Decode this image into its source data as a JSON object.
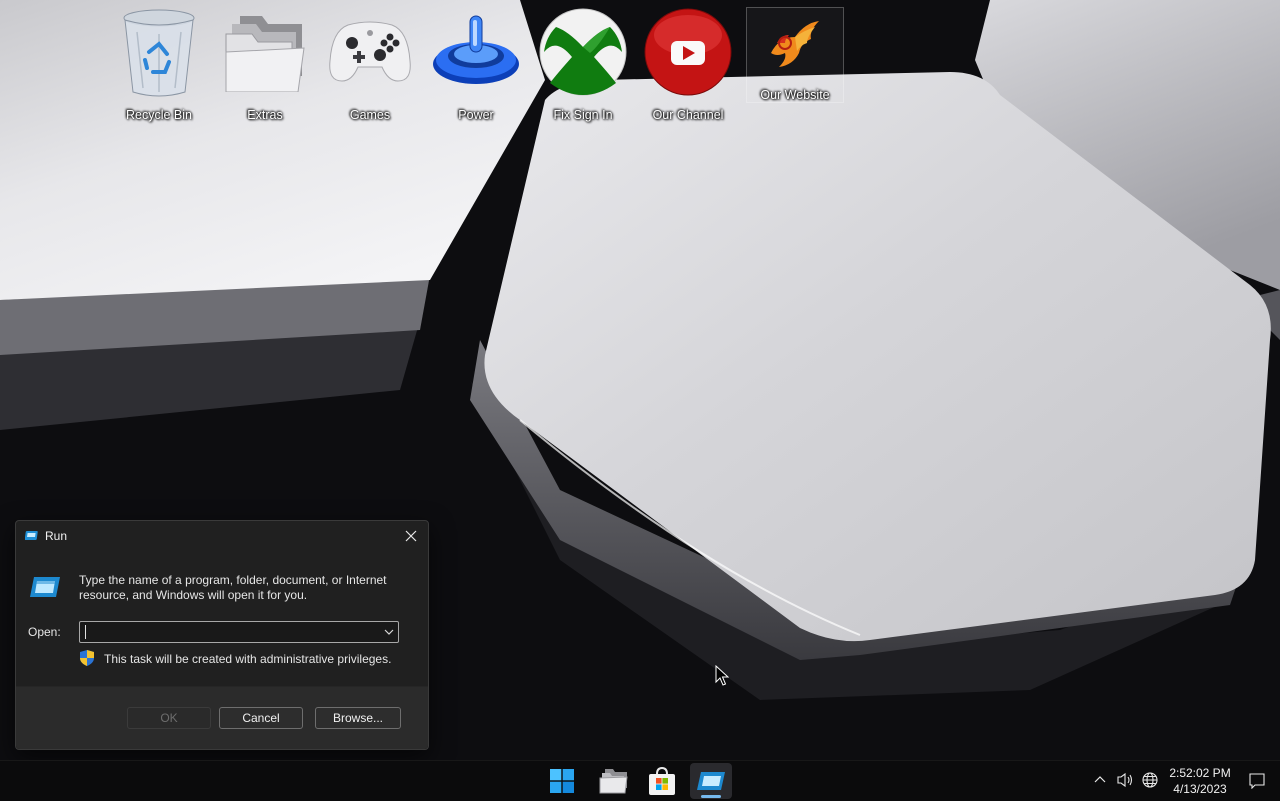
{
  "desktop": {
    "icons": [
      {
        "label": "Recycle Bin",
        "icon": "recycle-bin-icon"
      },
      {
        "label": "Extras",
        "icon": "folder-icon"
      },
      {
        "label": "Games",
        "icon": "gamepad-icon"
      },
      {
        "label": "Power",
        "icon": "power-icon"
      },
      {
        "label": "Fix Sign In",
        "icon": "xbox-icon"
      },
      {
        "label": "Our Channel",
        "icon": "youtube-icon"
      },
      {
        "label": "Our Website",
        "icon": "phoenix-logo-icon"
      }
    ]
  },
  "run_dialog": {
    "title": "Run",
    "description": "Type the name of a program, folder, document, or Internet resource, and Windows will open it for you.",
    "open_label": "Open:",
    "open_value": "",
    "admin_note": "This task will be created with administrative privileges.",
    "ok_label": "OK",
    "cancel_label": "Cancel",
    "browse_label": "Browse..."
  },
  "taskbar": {
    "items": [
      "start-icon",
      "file-explorer-icon",
      "microsoft-store-icon",
      "run-icon"
    ],
    "active_item": "run-icon",
    "clock": {
      "time": "2:52:02 PM",
      "date": "4/13/2023"
    }
  },
  "colors": {
    "accent": "#76b9ed",
    "dialog_bg": "#202020",
    "taskbar_bg": "#0b0b0c"
  }
}
